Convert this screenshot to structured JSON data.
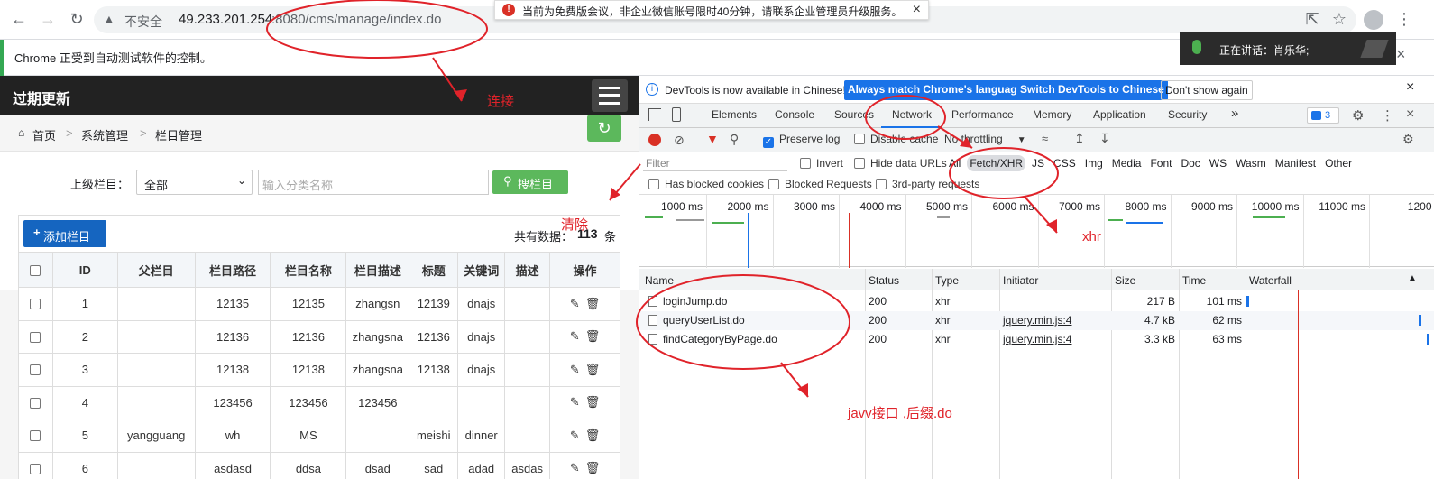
{
  "browser": {
    "insecure_label": "不安全",
    "url_host": "49.233.201.254",
    "url_rest": ":8080/cms/manage/index.do",
    "notice": "当前为免费版会议，非企业微信账号限时40分钟，请联系企业管理员升级服务。",
    "automation_msg": "Chrome 正受到自动测试软件的控制。",
    "speaking_label": "正在讲话：",
    "speaker": "肖乐华;"
  },
  "cms": {
    "title": "过期更新",
    "breadcrumb": [
      "首页",
      "系统管理",
      "栏目管理"
    ],
    "breadcrumb_sep": ">",
    "parent_label": "上级栏目：",
    "parent_select": "全部",
    "search_placeholder": "输入分类名称",
    "search_button": "搜栏目",
    "add_button": "添加栏目",
    "total_prefix": "共有数据：",
    "total_count": "113",
    "total_suffix": "条",
    "columns": [
      "ID",
      "父栏目",
      "栏目路径",
      "栏目名称",
      "栏目描述",
      "标题",
      "关键词",
      "描述",
      "操作"
    ],
    "rows": [
      [
        "1",
        "",
        "12135",
        "12135",
        "zhangsn",
        "12139",
        "dnajs",
        ""
      ],
      [
        "2",
        "",
        "12136",
        "12136",
        "zhangsna",
        "12136",
        "dnajs",
        ""
      ],
      [
        "3",
        "",
        "12138",
        "12138",
        "zhangsna",
        "12138",
        "dnajs",
        ""
      ],
      [
        "4",
        "",
        "123456",
        "123456",
        "123456",
        "",
        "",
        ""
      ],
      [
        "5",
        "yangguang",
        "wh",
        "MS",
        "",
        "meishi",
        "dinner",
        ""
      ],
      [
        "6",
        "",
        "asdasd",
        "ddsa",
        "dsad",
        "sad",
        "adad",
        "asdas"
      ]
    ]
  },
  "devtools": {
    "banner": "DevTools is now available in Chinese!",
    "btn_match": "Always match Chrome's language",
    "btn_switch": "Switch DevTools to Chinese",
    "btn_dismiss": "Don't show again",
    "tabs": [
      "Elements",
      "Console",
      "Sources",
      "Network",
      "Performance",
      "Memory",
      "Application",
      "Security"
    ],
    "more_tabs": "»",
    "issues_count": "3",
    "preserve_log": "Preserve log",
    "disable_cache": "Disable cache",
    "throttling": "No throttling",
    "filter_placeholder": "Filter",
    "invert": "Invert",
    "hide_data_urls": "Hide data URLs",
    "type_filters": [
      "All",
      "Fetch/XHR",
      "JS",
      "CSS",
      "Img",
      "Media",
      "Font",
      "Doc",
      "WS",
      "Wasm",
      "Manifest",
      "Other"
    ],
    "has_blocked_cookies": "Has blocked cookies",
    "blocked_requests": "Blocked Requests",
    "third_party": "3rd-party requests",
    "timeline_ticks": [
      "1000 ms",
      "2000 ms",
      "3000 ms",
      "4000 ms",
      "5000 ms",
      "6000 ms",
      "7000 ms",
      "8000 ms",
      "9000 ms",
      "10000 ms",
      "11000 ms",
      "1200"
    ],
    "table_headers": [
      "Name",
      "Status",
      "Type",
      "Initiator",
      "Size",
      "Time",
      "Waterfall"
    ],
    "requests": [
      {
        "name": "loginJump.do",
        "status": "200",
        "type": "xhr",
        "initiator": "",
        "size": "217 B",
        "time": "101 ms"
      },
      {
        "name": "queryUserList.do",
        "status": "200",
        "type": "xhr",
        "initiator": "jquery.min.js:4",
        "size": "4.7 kB",
        "time": "62 ms"
      },
      {
        "name": "findCategoryByPage.do",
        "status": "200",
        "type": "xhr",
        "initiator": "jquery.min.js:4",
        "size": "3.3 kB",
        "time": "63 ms"
      }
    ]
  },
  "annotations": {
    "connect": "连接",
    "clear": "清除",
    "xhr": "xhr",
    "java_api": "javv接口 ,后缀.do"
  }
}
